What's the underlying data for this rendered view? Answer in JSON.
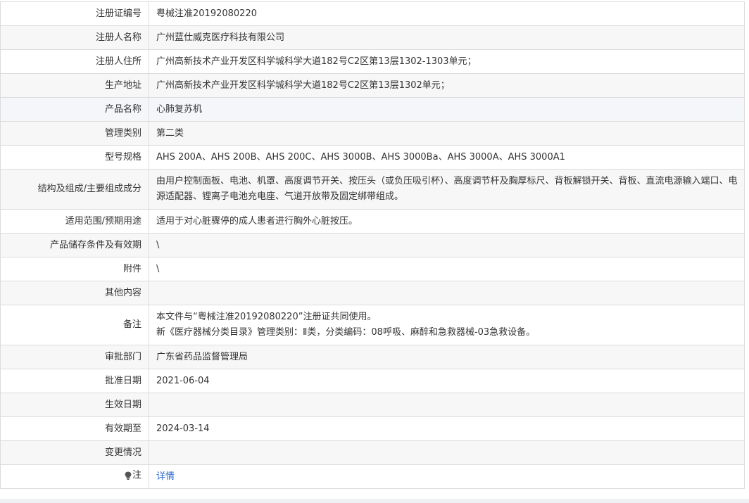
{
  "rows": [
    {
      "label": "注册证编号",
      "value": "粤械注准20192080220"
    },
    {
      "label": "注册人名称",
      "value": "广州蓝仕威克医疗科技有限公司"
    },
    {
      "label": "注册人住所",
      "value": "广州高新技术产业开发区科学城科学大道182号C2区第13层1302-1303单元；"
    },
    {
      "label": "生产地址",
      "value": "广州高新技术产业开发区科学城科学大道182号C2区第13层1302单元；"
    },
    {
      "label": "产品名称",
      "value": "心肺复苏机"
    },
    {
      "label": "管理类别",
      "value": "第二类"
    },
    {
      "label": "型号规格",
      "value": "AHS 200A、AHS 200B、AHS 200C、AHS 3000B、AHS 3000Ba、AHS 3000A、AHS 3000A1"
    },
    {
      "label": "结构及组成/主要组成成分",
      "value": "由用户控制面板、电池、机罩、高度调节开关、按压头（或负压吸引杯）、高度调节杆及胸厚标尺、背板解锁开关、背板、直流电源输入端口、电源适配器、锂离子电池充电座、气道开放带及固定绑带组成。"
    },
    {
      "label": "适用范围/预期用途",
      "value": "适用于对心脏骤停的成人患者进行胸外心脏按压。"
    },
    {
      "label": "产品储存条件及有效期",
      "value": "\\"
    },
    {
      "label": "附件",
      "value": "\\"
    },
    {
      "label": "其他内容",
      "value": ""
    },
    {
      "label": "备注",
      "line1": "本文件与“粤械注准20192080220”注册证共同使用。",
      "line2": "新《医疗器械分类目录》管理类别：Ⅱ类，分类编码：08呼吸、麻醉和急救器械-03急救设备。"
    },
    {
      "label": "审批部门",
      "value": "广东省药品监督管理局"
    },
    {
      "label": "批准日期",
      "value": "2021-06-04"
    },
    {
      "label": "生效日期",
      "value": ""
    },
    {
      "label": "有效期至",
      "value": "2024-03-14"
    },
    {
      "label": "变更情况",
      "value": ""
    },
    {
      "label": "注",
      "link": "详情",
      "icon": "lightbulb-icon"
    }
  ]
}
